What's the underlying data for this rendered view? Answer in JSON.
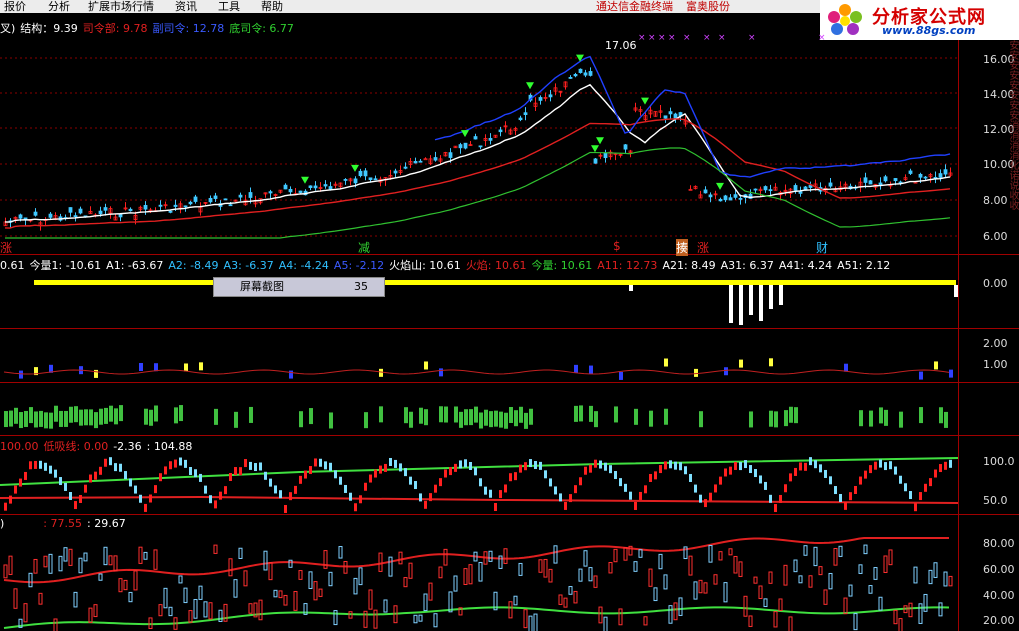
{
  "menu": {
    "items": [
      "报价",
      "分析",
      "扩展市场行情",
      "资讯",
      "工具",
      "帮助"
    ],
    "right_links": [
      "通达信金融终端",
      "富奥股份"
    ]
  },
  "logo": {
    "title": "分析家公式网",
    "url": "www.88gs.com"
  },
  "panel1": {
    "header": {
      "prefix": "叉)",
      "s1": "结构：9.39",
      "s2": "司令部: 9.78",
      "s3": "副司令: 12.78",
      "s4": "底司令: 6.77"
    },
    "peak_label": "17.06",
    "y_labels": [
      "16.00",
      "14.00",
      "12.00",
      "10.00",
      "8.00",
      "6.00"
    ],
    "signals": [
      "涨",
      "减",
      "$",
      "揍",
      "涨",
      "财"
    ]
  },
  "panel2": {
    "header": {
      "v0": "0.61",
      "v1": "今量1: -10.61",
      "v2": "A1: -63.67",
      "v3": "A2: -8.49",
      "v4": "A3: -6.37",
      "v5": "A4: -4.24",
      "v6": "A5: -2.12",
      "v7": "火焰山: 10.61",
      "v8": "火焰: 10.61",
      "v9": "今量: 10.61",
      "v10": "A11: 12.73",
      "v11": "A21: 8.49",
      "v12": "A31: 6.37",
      "v13": "A41: 4.24",
      "v14": "A51: 2.12"
    },
    "y_labels": [
      "0.00"
    ]
  },
  "popup": {
    "label": "屏幕截图",
    "value": "35"
  },
  "panel3": {
    "y_labels": [
      "2.00",
      "1.00"
    ]
  },
  "panel5": {
    "header": {
      "v0": "100.00",
      "v1": "低吸线: 0.00",
      "v2": "-2.36",
      "v3": ": 104.88"
    },
    "y_labels": [
      "100.0",
      "50.0"
    ]
  },
  "panel6": {
    "header": {
      "v0": ")",
      "v1": ": 77.55",
      "v2": ": 29.67"
    },
    "y_labels": [
      "80.00",
      "60.00",
      "40.00",
      "20.00"
    ]
  },
  "right_strip": "安安安安安安安安消消消消化诺说收收",
  "colors": {
    "bg": "#000000",
    "up": "#ff2020",
    "down": "#40c8ff",
    "grid": "#a00000"
  }
}
